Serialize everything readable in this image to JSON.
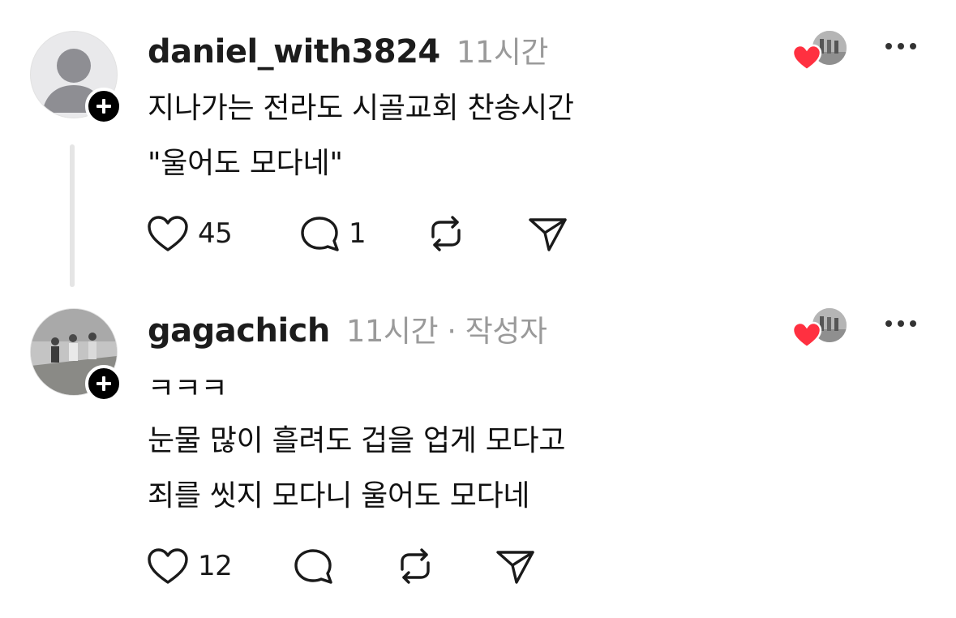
{
  "posts": [
    {
      "username": "daniel_with3824",
      "meta": "11시간",
      "lines": [
        "지나가는 전라도 시골교회 찬송시간",
        "\"울어도 모다네\""
      ],
      "likes": "45",
      "replies": "1",
      "avatar_icon": "default-avatar-icon"
    },
    {
      "username": "gagachich",
      "meta": "11시간 · 작성자",
      "lines": [
        "ㅋㅋㅋ",
        "눈물 많이 흘려도 겁을 업게 모다고",
        "죄를 씻지 모다니 울어도 모다네"
      ],
      "likes": "12",
      "replies": "",
      "avatar_icon": "photo-avatar"
    }
  ],
  "colors": {
    "heart": "#ff3040",
    "secondary_text": "#9a9a9a",
    "thread_line": "#e5e5e5",
    "follow_badge": "#000000"
  },
  "icons": [
    "heart-icon",
    "reply-icon",
    "repost-icon",
    "share-icon",
    "more-icon",
    "plus-icon"
  ]
}
